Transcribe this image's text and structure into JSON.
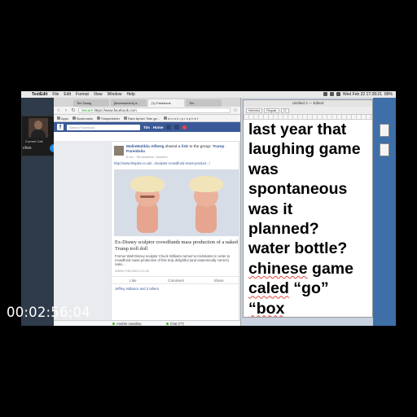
{
  "menubar": {
    "app": "TextEdit",
    "items": [
      "File",
      "Edit",
      "Format",
      "View",
      "Window",
      "Help"
    ],
    "clock": "Wed Feb 22 17:28:21",
    "battery": "89%"
  },
  "call": {
    "name": "Current Call",
    "side_label": "ches"
  },
  "browser": {
    "tabs": [
      "Tim Tsang",
      "[timemachine] d...",
      "(1) Facebook",
      "Tim"
    ],
    "url_secure": "Secure",
    "url": "https://www.facebook.com",
    "bookmarks": [
      "Apps",
      "Bookmarks",
      "SimpleAdder",
      "Rare Aphex Twin ge...",
      "m o n k • p r o p h e t"
    ]
  },
  "facebook": {
    "search_placeholder": "Search Facebook",
    "user": "Tim",
    "home": "Home",
    "post": {
      "author": "MalinMatilda Allberg",
      "verb": "shared a",
      "link_word": "link",
      "to_group": "to the group:",
      "group": "Trump Pareidolia",
      "meta": "8 hrs · Stromstahm, Sweden",
      "url": "http://www.thejoke.co.uk/.../sculptor-crowdfund-mass-product.../",
      "article_title": "Ex-Disney sculptor crowdfunds mass production of a naked Trump troll doll",
      "article_desc": "Former Walt Disney sculptor Chuck Williams turned to Kickstarter in order to crowdfund mass production of this truly delightful (and anatomically correct) nake...",
      "article_source": "WWW.THEJOKE.CO.UK",
      "actions": [
        "Like",
        "Comment",
        "Share"
      ],
      "reactions": "Jeffrey Vallance and 3 others"
    },
    "chat_person": "Andrée Aasolina",
    "chat_label": "Chat (77)"
  },
  "textedit": {
    "title": "Untitled 2 — Edited",
    "toolbar": [
      "Helvetica",
      "Regular",
      "12"
    ],
    "lines": [
      {
        "pre": "last year that",
        "sp": "",
        "post": ""
      },
      {
        "pre": "laughing game",
        "sp": "",
        "post": ""
      },
      {
        "pre": "was",
        "sp": "",
        "post": ""
      },
      {
        "pre": "spontaneous",
        "sp": "",
        "post": ""
      },
      {
        "pre": "was it",
        "sp": "",
        "post": ""
      },
      {
        "pre": "planned?",
        "sp": "",
        "post": ""
      },
      {
        "pre": "water bottle?",
        "sp": "",
        "post": ""
      },
      {
        "pre": "",
        "sp": "chinese",
        "post": " game"
      },
      {
        "pre": "",
        "sp": "caled",
        "post": " “go”"
      },
      {
        "pre": "",
        "sp": "“box",
        "post": ""
      }
    ]
  },
  "video": {
    "timecode": "00:02:56;04"
  }
}
